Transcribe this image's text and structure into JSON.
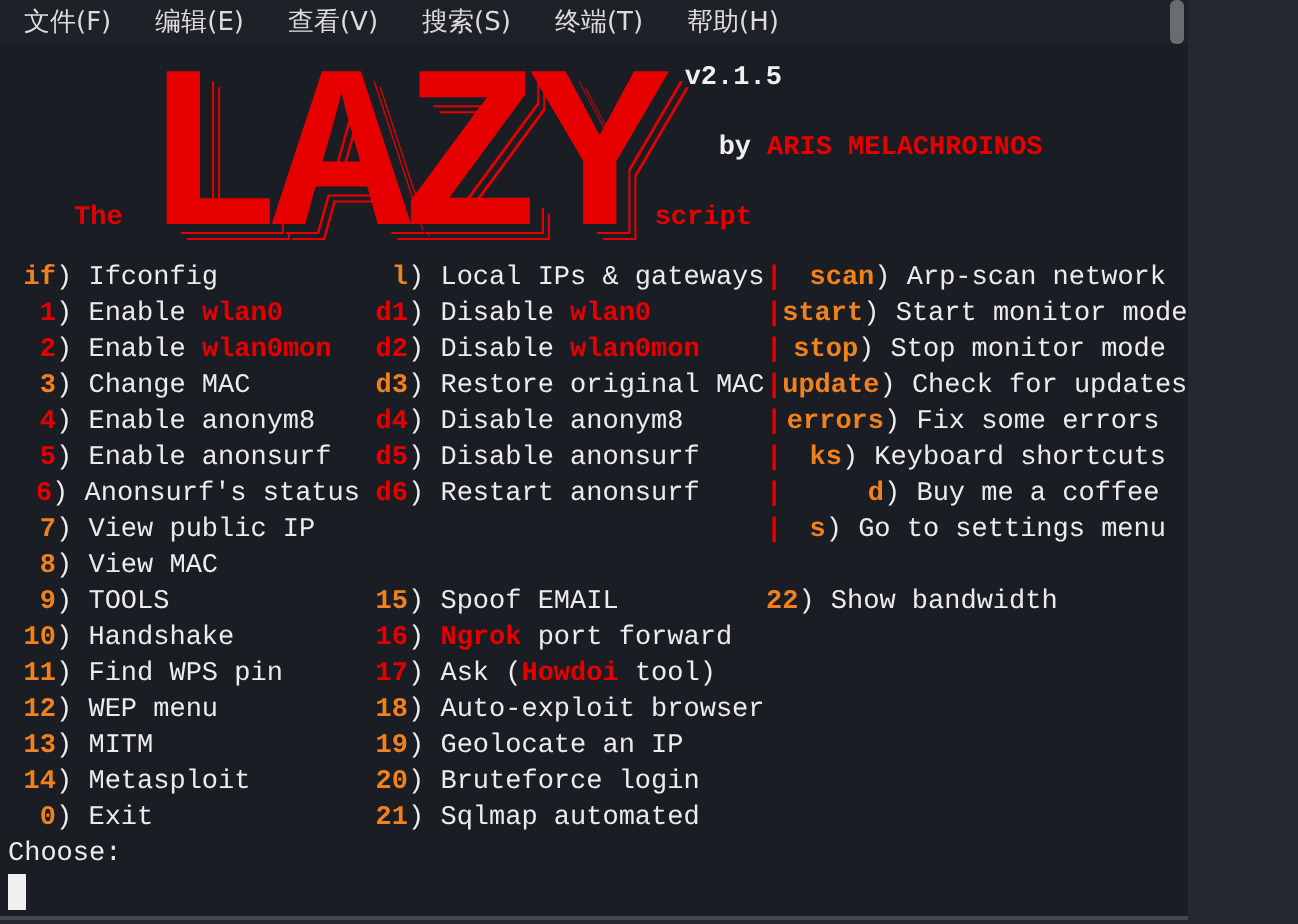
{
  "menu_bar": [
    {
      "label": "文件(F)"
    },
    {
      "label": "编辑(E)"
    },
    {
      "label": "查看(V)"
    },
    {
      "label": "搜索(S)"
    },
    {
      "label": "终端(T)"
    },
    {
      "label": "帮助(H)"
    }
  ],
  "header": {
    "prefix": "The",
    "logo": "LAZY",
    "suffix": "script",
    "version": "v2.1.5",
    "byline": "by",
    "author": "ARIS MELACHROINOS"
  },
  "rows": [
    {
      "left": {
        "key": "if",
        "color": "#f0821e",
        "close": ")",
        "parts": [
          {
            "text": "Ifconfig",
            "highlight": false
          }
        ]
      },
      "middle": {
        "key": "l",
        "color": "#f0821e",
        "close": ")",
        "parts": [
          {
            "text": "Local IPs & gateways",
            "highlight": false
          }
        ]
      },
      "divider": "|",
      "right": {
        "key": "scan",
        "color": "#f0821e",
        "close": ")",
        "parts": [
          {
            "text": "Arp-scan network",
            "highlight": false
          }
        ]
      }
    },
    {
      "left": {
        "key": "1",
        "color": "#e60000",
        "close": ")",
        "parts": [
          {
            "text": "Enable ",
            "highlight": false
          },
          {
            "text": "wlan0",
            "highlight": true
          }
        ]
      },
      "middle": {
        "key": "d1",
        "color": "#e60000",
        "close": ")",
        "parts": [
          {
            "text": "Disable ",
            "highlight": false
          },
          {
            "text": "wlan0",
            "highlight": true
          }
        ]
      },
      "divider": "|",
      "right": {
        "key": "start",
        "color": "#f0821e",
        "close": ")",
        "parts": [
          {
            "text": "Start monitor mode",
            "highlight": false
          }
        ]
      }
    },
    {
      "left": {
        "key": "2",
        "color": "#e60000",
        "close": ")",
        "parts": [
          {
            "text": "Enable ",
            "highlight": false
          },
          {
            "text": "wlan0mon",
            "highlight": true
          }
        ]
      },
      "middle": {
        "key": "d2",
        "color": "#e60000",
        "close": ")",
        "parts": [
          {
            "text": "Disable ",
            "highlight": false
          },
          {
            "text": "wlan0mon",
            "highlight": true
          }
        ]
      },
      "divider": "|",
      "right": {
        "key": "stop",
        "color": "#f0821e",
        "close": ")",
        "parts": [
          {
            "text": "Stop monitor mode",
            "highlight": false
          }
        ]
      }
    },
    {
      "left": {
        "key": "3",
        "color": "#f0821e",
        "close": ")",
        "parts": [
          {
            "text": "Change MAC",
            "highlight": false
          }
        ]
      },
      "middle": {
        "key": "d3",
        "color": "#f0821e",
        "close": ")",
        "parts": [
          {
            "text": "Restore original MAC",
            "highlight": false
          }
        ]
      },
      "divider": "|",
      "right": {
        "key": "update",
        "color": "#f0821e",
        "close": ")",
        "parts": [
          {
            "text": "Check for updates",
            "highlight": false
          }
        ]
      }
    },
    {
      "left": {
        "key": "4",
        "color": "#e60000",
        "close": ")",
        "parts": [
          {
            "text": "Enable anonym8",
            "highlight": false
          }
        ]
      },
      "middle": {
        "key": "d4",
        "color": "#e60000",
        "close": ")",
        "parts": [
          {
            "text": "Disable anonym8",
            "highlight": false
          }
        ]
      },
      "divider": "|",
      "right": {
        "key": "errors",
        "color": "#f0821e",
        "close": ")",
        "parts": [
          {
            "text": "Fix some errors",
            "highlight": false
          }
        ]
      }
    },
    {
      "left": {
        "key": "5",
        "color": "#e60000",
        "close": ")",
        "parts": [
          {
            "text": "Enable anonsurf",
            "highlight": false
          }
        ]
      },
      "middle": {
        "key": "d5",
        "color": "#e60000",
        "close": ")",
        "parts": [
          {
            "text": "Disable anonsurf",
            "highlight": false
          }
        ]
      },
      "divider": "|",
      "right": {
        "key": "ks",
        "color": "#f0821e",
        "close": ")",
        "parts": [
          {
            "text": "Keyboard shortcuts",
            "highlight": false
          }
        ]
      }
    },
    {
      "left": {
        "key": "6",
        "color": "#e60000",
        "close": ")",
        "parts": [
          {
            "text": "Anonsurf's status",
            "highlight": false
          }
        ]
      },
      "middle": {
        "key": "d6",
        "color": "#e60000",
        "close": ")",
        "parts": [
          {
            "text": "Restart anonsurf",
            "highlight": false
          }
        ]
      },
      "divider": "|",
      "right": {
        "key": "d",
        "color": "#f0821e",
        "close": ")",
        "parts": [
          {
            "text": "Buy me a coffee",
            "highlight": false
          }
        ]
      }
    },
    {
      "left": {
        "key": "7",
        "color": "#f0821e",
        "close": ")",
        "parts": [
          {
            "text": "View public IP",
            "highlight": false
          }
        ]
      },
      "divider": "|",
      "right": {
        "key": "s",
        "color": "#f0821e",
        "close": ")",
        "parts": [
          {
            "text": "Go to settings menu",
            "highlight": false
          }
        ]
      }
    },
    {
      "left": {
        "key": "8",
        "color": "#f0821e",
        "close": ")",
        "parts": [
          {
            "text": "View MAC",
            "highlight": false
          }
        ]
      }
    },
    {
      "left": {
        "key": "9",
        "color": "#f0821e",
        "close": ")",
        "parts": [
          {
            "text": "TOOLS",
            "highlight": false
          }
        ]
      },
      "middle": {
        "key": "15",
        "color": "#f0821e",
        "close": ")",
        "parts": [
          {
            "text": "Spoof EMAIL",
            "highlight": false
          }
        ]
      },
      "right": {
        "key": "22",
        "color": "#f0821e",
        "close": ")",
        "parts": [
          {
            "text": "Show bandwidth",
            "highlight": false
          }
        ]
      }
    },
    {
      "left": {
        "key": "10",
        "color": "#f0821e",
        "close": ")",
        "parts": [
          {
            "text": "Handshake",
            "highlight": false
          }
        ]
      },
      "middle": {
        "key": "16",
        "color": "#e60000",
        "close": ")",
        "parts": [
          {
            "text": "Ngrok",
            "highlight": true
          },
          {
            "text": " port forward",
            "highlight": false
          }
        ]
      }
    },
    {
      "left": {
        "key": "11",
        "color": "#f0821e",
        "close": ")",
        "parts": [
          {
            "text": "Find WPS pin",
            "highlight": false
          }
        ]
      },
      "middle": {
        "key": "17",
        "color": "#e60000",
        "close": ")",
        "parts": [
          {
            "text": "Ask (",
            "highlight": false
          },
          {
            "text": "Howdoi",
            "highlight": true
          },
          {
            "text": " tool)",
            "highlight": false
          }
        ]
      }
    },
    {
      "left": {
        "key": "12",
        "color": "#f0821e",
        "close": ")",
        "parts": [
          {
            "text": "WEP menu",
            "highlight": false
          }
        ]
      },
      "middle": {
        "key": "18",
        "color": "#f0821e",
        "close": ")",
        "parts": [
          {
            "text": "Auto-exploit browser",
            "highlight": false
          }
        ]
      }
    },
    {
      "left": {
        "key": "13",
        "color": "#f0821e",
        "close": ")",
        "parts": [
          {
            "text": "MITM",
            "highlight": false
          }
        ]
      },
      "middle": {
        "key": "19",
        "color": "#f0821e",
        "close": ")",
        "parts": [
          {
            "text": "Geolocate an IP",
            "highlight": false
          }
        ]
      }
    },
    {
      "left": {
        "key": "14",
        "color": "#f0821e",
        "close": ")",
        "parts": [
          {
            "text": "Metasploit",
            "highlight": false
          }
        ]
      },
      "middle": {
        "key": "20",
        "color": "#f0821e",
        "close": ")",
        "parts": [
          {
            "text": "Bruteforce login",
            "highlight": false
          }
        ]
      }
    },
    {
      "left": {
        "key": "0",
        "color": "#f0821e",
        "close": ")",
        "parts": [
          {
            "text": "Exit",
            "highlight": false
          }
        ]
      },
      "middle": {
        "key": "21",
        "color": "#f0821e",
        "close": ")",
        "parts": [
          {
            "text": "Sqlmap automated",
            "highlight": false
          }
        ]
      }
    }
  ],
  "prompt": "Choose:"
}
